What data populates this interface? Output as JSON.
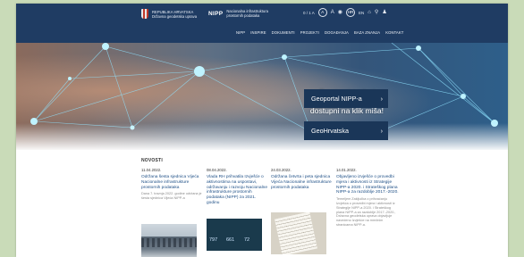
{
  "header": {
    "org_line1": "REPUBLIKA HRVATSKA",
    "org_line2": "Državna geodetska uprava",
    "nipp_logo": "NIPP",
    "nipp_line1": "Nacionalna infrastruktura",
    "nipp_line2": "prostornih podataka",
    "util_text": "0 / 1 A",
    "font_small": "A",
    "font_large": "A",
    "lang_hr": "HR",
    "lang_en": "EN",
    "icons": [
      "contrast-icon",
      "home-icon",
      "search-icon",
      "user-icon"
    ]
  },
  "nav": {
    "items": [
      "NIPP",
      "INSPIRE",
      "DOKUMENTI",
      "PROJEKTI",
      "DOGAĐANJA",
      "BAZA ZNANJA",
      "KONTAKT"
    ]
  },
  "hero": {
    "tagline": "Prostorni podaci Republike Hrvatske dostupni na klik miša!",
    "button1": "Geoportal NIPP-a",
    "button2": "GeoHrvatska",
    "arrow": "›"
  },
  "news": {
    "title": "NOVOSTI",
    "items": [
      {
        "date": "11.04.2022.",
        "title": "Održana šesta sjednica Vijeća Nacionalne infrastrukture prostornih podataka",
        "excerpt": "Dana 7. travnja 2022. godine održana je šesta sjednica Vijeća NIPP-a"
      },
      {
        "date": "08.04.2022.",
        "title": "Vlada RH prihvatila Izvješće o aktivnostima na uspostavi, održavanju i razvoju Nacionalne infrastrukture prostornih podataka (NIPP) za 2021. godinu",
        "thumb_values": [
          "797",
          "661",
          "72"
        ]
      },
      {
        "date": "24.03.2022.",
        "title": "Održana četvrta i peta sjednica Vijeća Nacionalne infrastrukture prostornih podataka"
      },
      {
        "date": "14.01.2022.",
        "title": "Objavljeno izvješće o provedbi mjera i aktivnosti iz Strategije NIPP-a 2020. i Strateškog plana NIPP-a za razdoblje 2017.-2020.",
        "excerpt": "Temeljem Zaključka o prihvaćanju Izvješća o provedbi mjera i aktivnosti iz Strategije NIPP-a 2020. i Strateškog plana NIPP-a za razdoblje 2017.-2020., Državna geodetska uprava objavljuje navedeno Izvješće na mrežnim stranicama NIPP-a."
      }
    ]
  }
}
